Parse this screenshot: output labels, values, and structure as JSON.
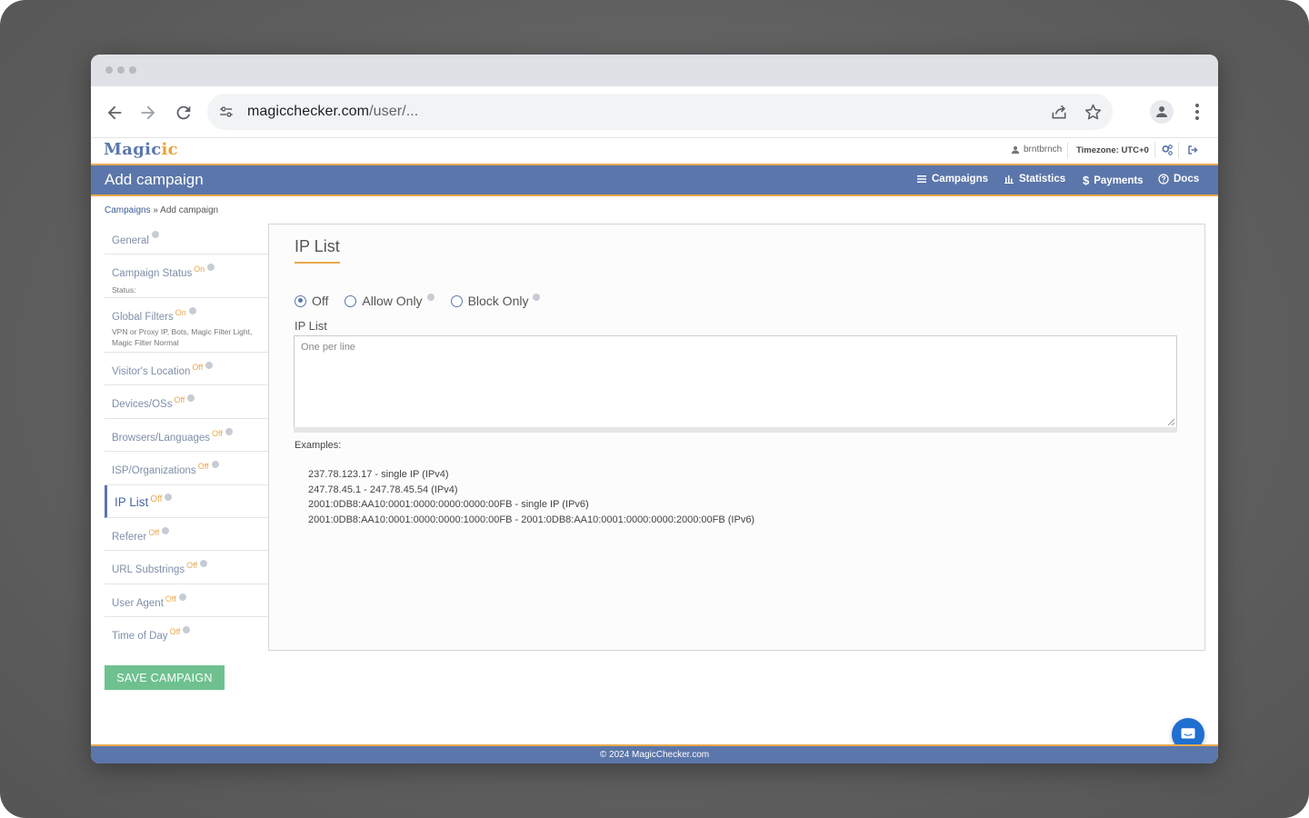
{
  "browser": {
    "url_host": "magicchecker.com",
    "url_path": "/user/..."
  },
  "site": {
    "logo": "Magic",
    "logo_accent": "ic",
    "username": "brntbrnch",
    "timezone": "Timezone: UTC+0"
  },
  "header": {
    "title": "Add campaign",
    "nav": {
      "campaigns": "Campaigns",
      "statistics": "Statistics",
      "payments": "Payments",
      "docs": "Docs"
    }
  },
  "breadcrumb": {
    "parent": "Campaigns",
    "separator": " » ",
    "current": "Add campaign"
  },
  "sidebar": {
    "items": [
      {
        "label": "General",
        "status": "",
        "sub": ""
      },
      {
        "label": "Campaign Status",
        "status": "On",
        "sub": "Status:"
      },
      {
        "label": "Global Filters",
        "status": "On",
        "sub": "VPN or Proxy IP, Bots, Magic Filter Light, Magic Filter Normal"
      },
      {
        "label": "Visitor's Location",
        "status": "Off",
        "sub": ""
      },
      {
        "label": "Devices/OSs",
        "status": "Off",
        "sub": ""
      },
      {
        "label": "Browsers/Languages",
        "status": "Off",
        "sub": ""
      },
      {
        "label": "ISP/Organizations",
        "status": "Off",
        "sub": ""
      },
      {
        "label": "IP List",
        "status": "Off",
        "sub": ""
      },
      {
        "label": "Referer",
        "status": "Off",
        "sub": ""
      },
      {
        "label": "URL Substrings",
        "status": "Off",
        "sub": ""
      },
      {
        "label": "User Agent",
        "status": "Off",
        "sub": ""
      },
      {
        "label": "Time of Day",
        "status": "Off",
        "sub": ""
      }
    ]
  },
  "main": {
    "section_title": "IP List",
    "radios": {
      "off": "Off",
      "allow_only": "Allow Only",
      "block_only": "Block Only",
      "selected": "Off"
    },
    "field_label": "IP List",
    "textarea_placeholder": "One per line",
    "examples_label": "Examples:",
    "examples": [
      "237.78.123.17 - single IP (IPv4)",
      "247.78.45.1 - 247.78.45.54 (IPv4)",
      "2001:0DB8:AA10:0001:0000:0000:0000:00FB - single IP (IPv6)",
      "2001:0DB8:AA10:0001:0000:0000:1000:00FB - 2001:0DB8:AA10:0001:0000:0000:2000:00FB (IPv6)"
    ]
  },
  "actions": {
    "save": "SAVE CAMPAIGN"
  },
  "footer": {
    "text": "© 2024 MagicChecker.com"
  },
  "colors": {
    "brand_blue": "#5b76aa",
    "accent_orange": "#e9a94b",
    "save_green": "#6ec18f",
    "chat_blue": "#1f6fd1"
  },
  "icons": {
    "back": "arrow-left-icon",
    "forward": "arrow-right-icon",
    "reload": "reload-icon",
    "site_settings": "tune-icon",
    "share": "share-icon",
    "bookmark": "star-icon",
    "profile": "person-icon",
    "menu": "kebab-icon",
    "user": "user-icon",
    "settings": "gears-icon",
    "logout": "logout-icon",
    "chat": "chat-icon"
  }
}
